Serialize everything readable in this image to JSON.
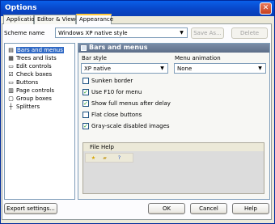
{
  "window": {
    "title": "Options",
    "close_glyph": "✕"
  },
  "tabs": [
    {
      "label": "Application",
      "active": false
    },
    {
      "label": "Editor & Viewers",
      "active": false
    },
    {
      "label": "Appearance",
      "active": true
    }
  ],
  "scheme": {
    "label": "Scheme name",
    "value": "Windows XP native style",
    "save_as_label": "Save As...",
    "delete_label": "Delete"
  },
  "sidebar": {
    "items": [
      {
        "label": "Bars and menus",
        "icon": "menu-icon",
        "glyph": "▤",
        "selected": true
      },
      {
        "label": "Trees and lists",
        "icon": "tree-icon",
        "glyph": "▦",
        "selected": false
      },
      {
        "label": "Edit controls",
        "icon": "edit-icon",
        "glyph": "▭",
        "selected": false
      },
      {
        "label": "Check boxes",
        "icon": "checkbox-icon",
        "glyph": "☑",
        "selected": false
      },
      {
        "label": "Buttons",
        "icon": "button-icon",
        "glyph": "▭",
        "selected": false
      },
      {
        "label": "Page controls",
        "icon": "page-icon",
        "glyph": "▥",
        "selected": false
      },
      {
        "label": "Group boxes",
        "icon": "group-icon",
        "glyph": "▢",
        "selected": false
      },
      {
        "label": "Splitters",
        "icon": "splitter-icon",
        "glyph": "┼",
        "selected": false
      }
    ]
  },
  "main": {
    "section_title": "Bars and menus",
    "bar_style": {
      "label": "Bar style",
      "value": "XP native"
    },
    "menu_animation": {
      "label": "Menu animation",
      "value": "None"
    },
    "options": [
      {
        "label": "Sunken border",
        "checked": false
      },
      {
        "label": "Use F10 for menu",
        "checked": true
      },
      {
        "label": "Show full menus after delay",
        "checked": true
      },
      {
        "label": "Flat close buttons",
        "checked": false
      },
      {
        "label": "Gray-scale disabled images",
        "checked": true
      }
    ],
    "check_glyph": "✓",
    "preview": {
      "menu_items": [
        "File",
        "Help"
      ],
      "tool_icons": [
        "open-icon",
        "folder-icon",
        "help-icon"
      ]
    }
  },
  "footer": {
    "export_label": "Export settings...",
    "ok_label": "OK",
    "cancel_label": "Cancel",
    "help_label": "Help"
  },
  "colors": {
    "title_bar": "#0a5fe8",
    "selection": "#316ac5",
    "section_header": "#6b7c97",
    "check_mark": "#21a121"
  }
}
